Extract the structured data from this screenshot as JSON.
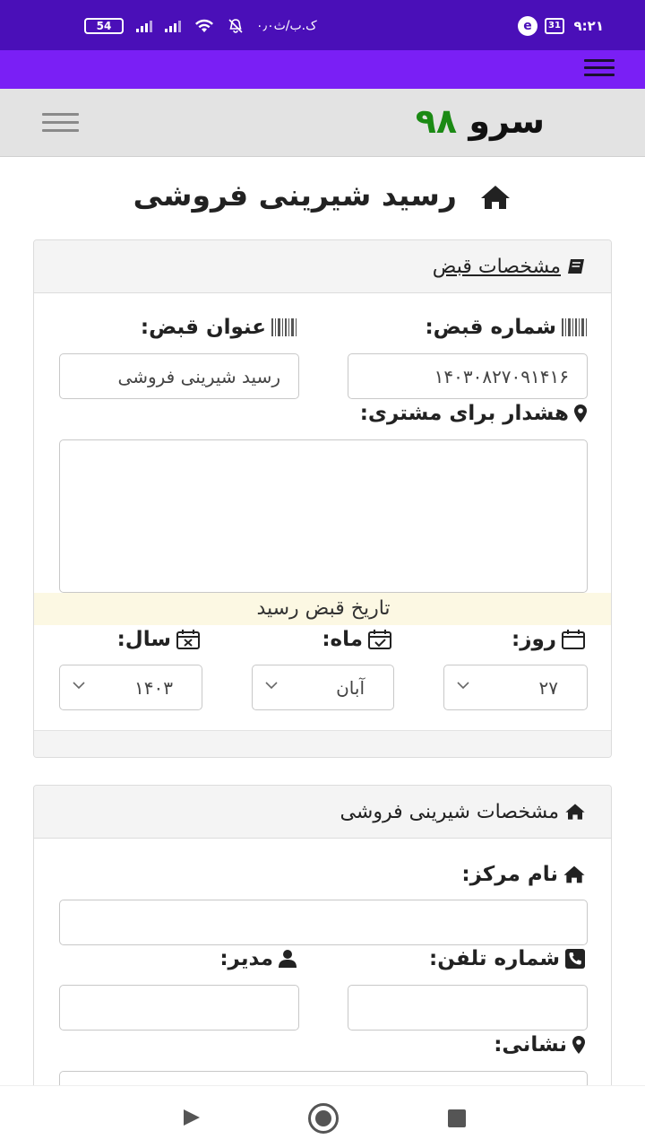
{
  "status_bar": {
    "time": "۹:۲۱",
    "calendar_day": "31",
    "carrier_text": "۰٫۰ک.ب/ث",
    "battery": "54",
    "icons": [
      "battery-icon",
      "signal-icon",
      "wifi-icon",
      "mute-icon",
      "browser-icon",
      "calendar-icon"
    ]
  },
  "navbar": {
    "brand_word": "سرو",
    "brand_number": "۹۸",
    "brand_number_color": "#1b8a14"
  },
  "page": {
    "title": "رسید شیرینی فروشی"
  },
  "receipt_panel": {
    "header": "مشخصات قبض",
    "receipt_number_label": "شماره قبض:",
    "receipt_number_value": "۱۴۰۳۰۸۲۷۰۹۱۴۱۶",
    "receipt_title_label": "عنوان قبض:",
    "receipt_title_value": "رسید شیرینی فروشی",
    "warning_label": "هشدار برای مشتری:",
    "warning_value": "",
    "date_banner": "تاریخ قبض رسید",
    "day_label": "روز:",
    "day_value": "۲۷",
    "month_label": "ماه:",
    "month_value": "آبان",
    "year_label": "سال:",
    "year_value": "۱۴۰۳"
  },
  "shop_panel": {
    "header": "مشخصات شیرینی فروشی",
    "center_name_label": "نام مرکز:",
    "center_name_value": "",
    "phone_label": "شماره تلفن:",
    "phone_value": "",
    "manager_label": "مدیر:",
    "manager_value": "",
    "address_label": "نشانی:"
  },
  "colors": {
    "status_bar": "#4a0fb8",
    "top_bar": "#7a1ff5",
    "navbar": "#e3e3e3",
    "date_banner": "#fcf8e3"
  }
}
